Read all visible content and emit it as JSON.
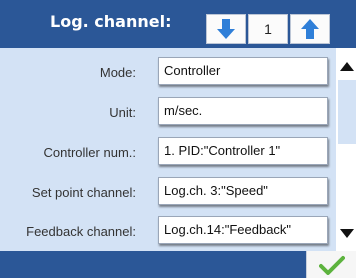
{
  "header": {
    "title": "Log. channel:",
    "channel_number": "1"
  },
  "fields": [
    {
      "label": "Mode:",
      "value": "Controller"
    },
    {
      "label": "Unit:",
      "value": "m/sec."
    },
    {
      "label": "Controller num.:",
      "value": "1. PID:\"Controller 1\""
    },
    {
      "label": "Set point channel:",
      "value": "Log.ch. 3:\"Speed\""
    },
    {
      "label": "Feedback channel:",
      "value": "Log.ch.14:\"Feedback\""
    }
  ],
  "colors": {
    "header_bg": "#2b5797",
    "content_bg": "#d3e2f5",
    "arrow_blue": "#2f7fd8",
    "ok_green": "#5db33e"
  },
  "icons": {
    "down": "arrow-down-icon",
    "up": "arrow-up-icon",
    "scroll_up": "triangle-up-icon",
    "scroll_down": "triangle-down-icon",
    "ok": "checkmark-icon"
  }
}
